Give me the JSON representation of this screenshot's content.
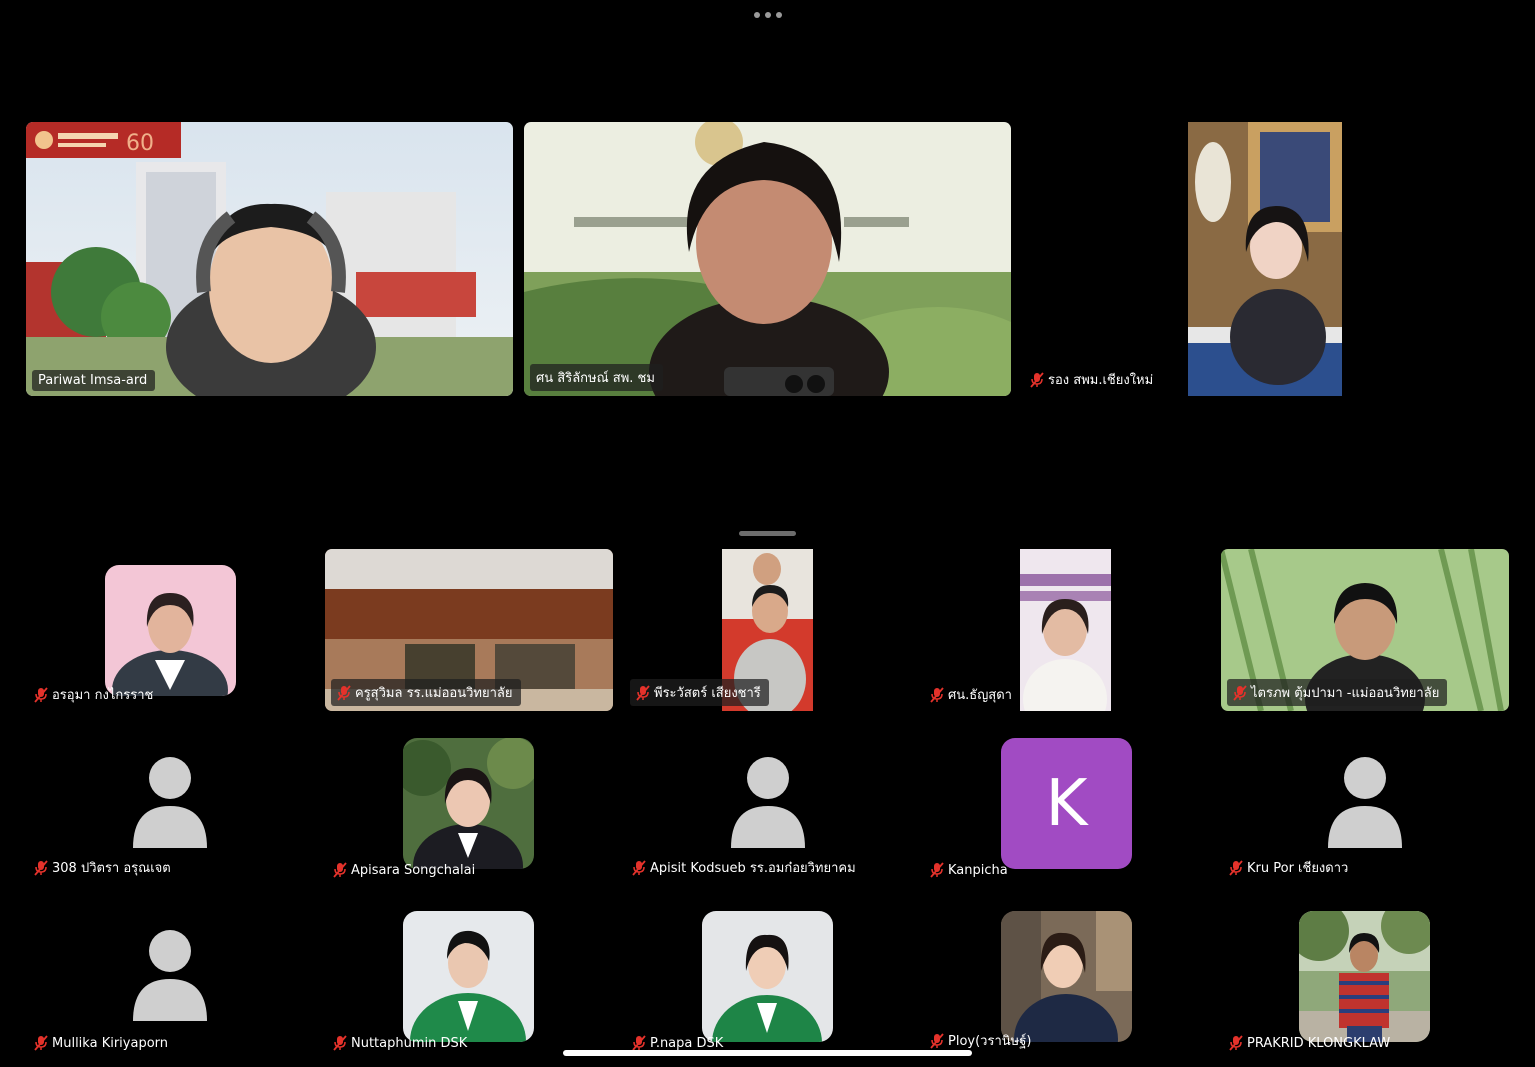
{
  "window": {
    "menu_icon": "more-dots-icon",
    "home_indicator": "home-bar"
  },
  "speakers": [
    {
      "name": "Pariwat Imsa-ard",
      "muted": false
    },
    {
      "name": "ศน สิริลักษณ์  สพ. ชม",
      "muted": false
    },
    {
      "name": "รอง สพม.เชียงใหม่",
      "muted": true
    }
  ],
  "gallery": [
    {
      "name": "อรอุมา กงไกรราช",
      "muted": true
    },
    {
      "name": "ครูสุวิมล รร.แม่ออนวิทยาลัย",
      "muted": true
    },
    {
      "name": "พีระวัสตร์ เสียงชารี",
      "muted": true
    },
    {
      "name": "ศน.ธัญสุดา",
      "muted": true
    },
    {
      "name": "ไตรภพ ตุ้มปามา -แม่ออนวิทยาลัย",
      "muted": true
    },
    {
      "name": "308 ปวิตรา อรุณเจต",
      "muted": true
    },
    {
      "name": "Apisara Songchalai",
      "muted": true
    },
    {
      "name": "Apisit Kodsueb รร.อมก๋อยวิทยาคม",
      "muted": true
    },
    {
      "name": "Kanpicha",
      "muted": true,
      "initial": "K",
      "color": "#a14bc3"
    },
    {
      "name": "Kru Por เชียงดาว",
      "muted": true
    },
    {
      "name": "Mullika Kiriyaporn",
      "muted": true
    },
    {
      "name": "Nuttaphumin DSK",
      "muted": true
    },
    {
      "name": "P.napa DSK",
      "muted": true
    },
    {
      "name": "Ploy(วรานิษฐ์)",
      "muted": true
    },
    {
      "name": "PRAKRID KLONGKLAW",
      "muted": true
    }
  ]
}
